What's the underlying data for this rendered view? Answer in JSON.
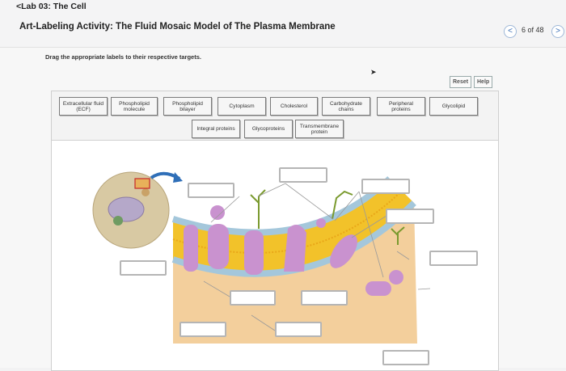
{
  "header": {
    "back_link": "<Lab 03: The Cell",
    "title": "Art-Labeling Activity: The Fluid Mosaic Model of The Plasma Membrane",
    "prev_icon": "<",
    "next_icon": ">",
    "page_indicator": "6 of 48"
  },
  "activity": {
    "instructions": "Drag the appropriate labels to their respective targets.",
    "reset_label": "Reset",
    "help_label": "Help"
  },
  "label_bank": [
    "Extracellular fluid (ECF)",
    "Phospholipid molecule",
    "Phospholipid bilayer",
    "Cytoplasm",
    "Cholesterol",
    "Carbohydrate chains",
    "Peripheral proteins",
    "Glycolipid",
    "Integral proteins",
    "Glycoproteins",
    "Transmembrane protein"
  ],
  "drop_targets_count": 11,
  "colors": {
    "cytoplasm": "#f3cf9c",
    "bilayer_heads": "#a4c7db",
    "bilayer_tails": "#f2c22a",
    "proteins": "#c992cf",
    "cell_image": "#d7c9a8",
    "arrow": "#2f6fb8"
  }
}
